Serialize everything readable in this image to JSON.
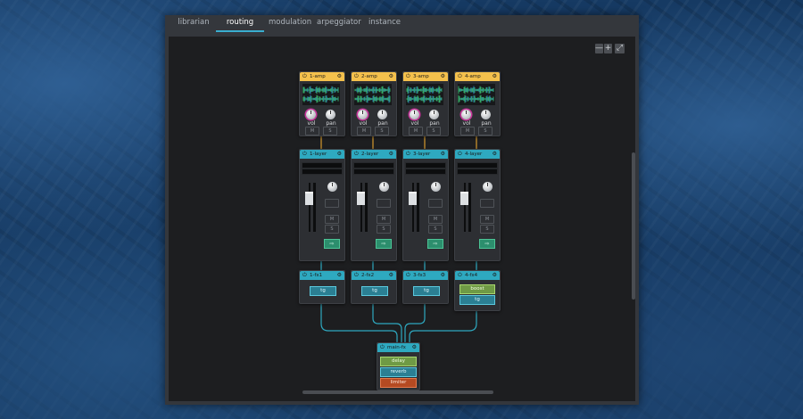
{
  "tabs": [
    {
      "label": "librarian",
      "active": false
    },
    {
      "label": "routing",
      "active": true
    },
    {
      "label": "modulation",
      "active": false
    },
    {
      "label": "arpeggiator",
      "active": false
    },
    {
      "label": "instance",
      "active": false
    }
  ],
  "zoom": {
    "out": "—",
    "in": "+",
    "fit": "⤢"
  },
  "header_icons": {
    "power": "⏻",
    "gear": "⚙"
  },
  "amps": [
    {
      "title": "1-amp",
      "vol": "vol",
      "pan": "pan",
      "mute": "M",
      "solo": "S"
    },
    {
      "title": "2-amp",
      "vol": "vol",
      "pan": "pan",
      "mute": "M",
      "solo": "S"
    },
    {
      "title": "3-amp",
      "vol": "vol",
      "pan": "pan",
      "mute": "M",
      "solo": "S"
    },
    {
      "title": "4-amp",
      "vol": "vol",
      "pan": "pan",
      "mute": "M",
      "solo": "S"
    }
  ],
  "layers": [
    {
      "title": "1-layer",
      "route": "⇨",
      "mute": "M",
      "solo": "S"
    },
    {
      "title": "2-layer",
      "route": "⇨",
      "mute": "M",
      "solo": "S"
    },
    {
      "title": "3-layer",
      "route": "⇨",
      "mute": "M",
      "solo": "S"
    },
    {
      "title": "4-layer",
      "route": "⇨",
      "mute": "M",
      "solo": "S"
    }
  ],
  "fx": [
    {
      "title": "1-fx1",
      "slots": [
        "tg"
      ]
    },
    {
      "title": "2-fx2",
      "slots": [
        "tg"
      ]
    },
    {
      "title": "3-fx3",
      "slots": [
        "tg"
      ]
    },
    {
      "title": "4-fx4",
      "slots": [
        "boost",
        "tg"
      ]
    }
  ],
  "main_fx": {
    "title": "main-fx",
    "slots": [
      "delay",
      "reverb",
      "limiter"
    ]
  },
  "colors": {
    "amp_header": "#f4c04c",
    "layer_header": "#2ea9c0",
    "wire": "#2ea9c0",
    "amp_wire": "#d59a2e",
    "slot_teal": "#2b7f93",
    "slot_green": "#6f9a45",
    "slot_orange": "#b54a22",
    "vol_knob_ring": "#c9359b"
  }
}
